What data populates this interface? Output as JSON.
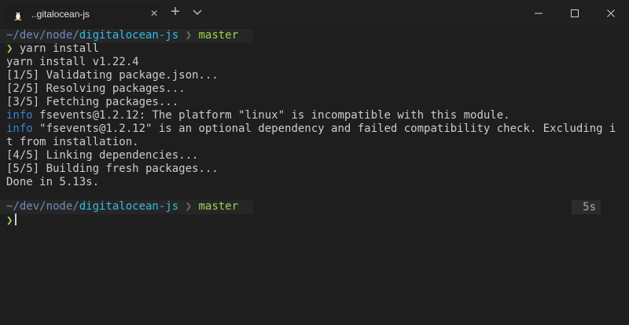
{
  "window": {
    "tab_title": "..gitalocean-js",
    "tab_close_symbol": "×",
    "new_tab_symbol": "+",
    "icons": [
      "linux-tux-icon",
      "close-icon",
      "plus-icon",
      "chevron-down-icon",
      "minimize-icon",
      "maximize-icon",
      "close-window-icon"
    ]
  },
  "prompt": {
    "tilde_path": "~/dev/node/",
    "repo": "digitalocean-js",
    "separator": "❯",
    "branch": "master",
    "chevron": "❯"
  },
  "output": {
    "command": "yarn install",
    "lines": [
      "yarn install v1.22.4",
      "[1/5] Validating package.json...",
      "[2/5] Resolving packages...",
      "[3/5] Fetching packages...",
      "fsevents@1.2.12: The platform \"linux\" is incompatible with this module.",
      "\"fsevents@1.2.12\" is an optional dependency and failed compatibility check. Excluding i",
      "t from installation.",
      "[4/5] Linking dependencies...",
      "[5/5] Building fresh packages...",
      "Done in 5.13s."
    ],
    "info_label": "info"
  },
  "second_prompt": {
    "duration": "5s"
  },
  "colors": {
    "background": "#1e1e1e",
    "titlebar": "#202020",
    "repo": "#35b9e6",
    "branch": "#9fd356",
    "info": "#3a82d8"
  }
}
